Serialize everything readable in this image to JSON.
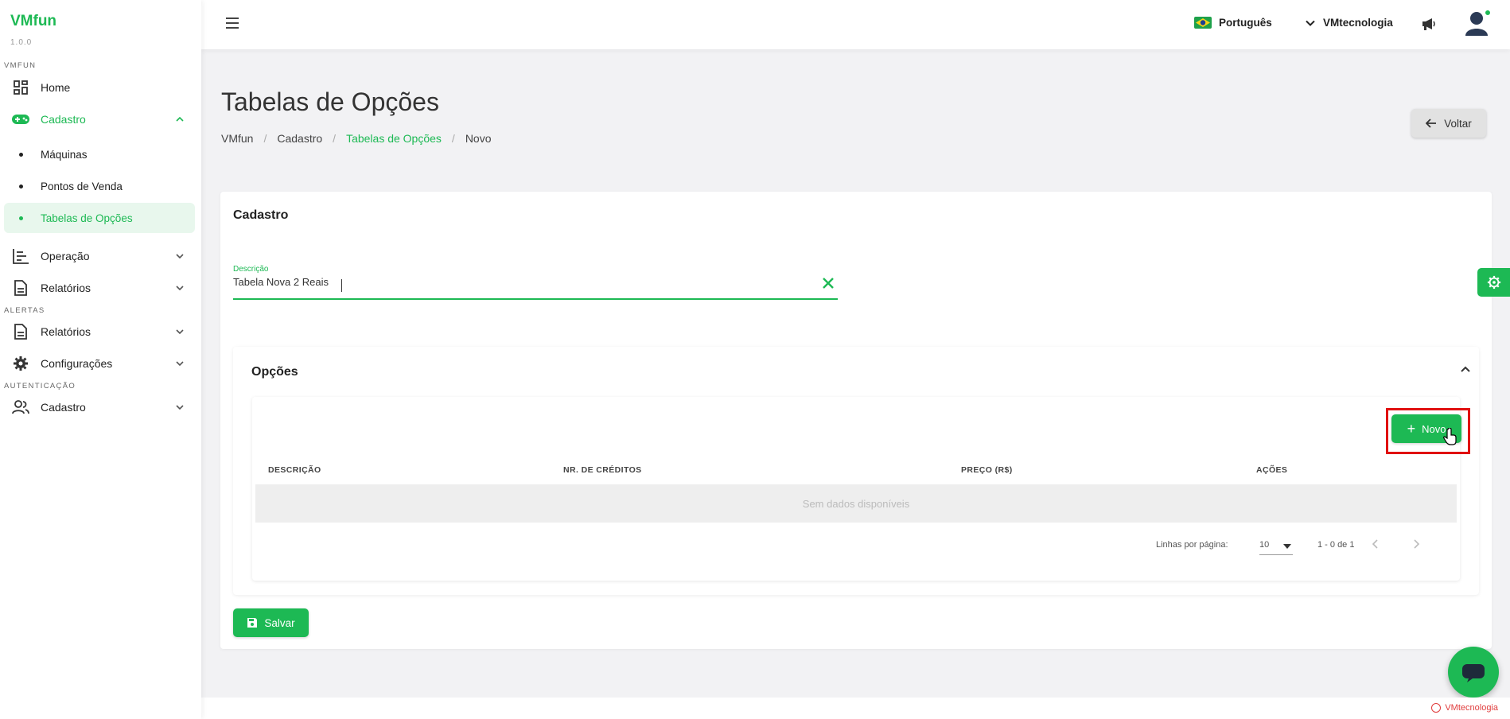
{
  "brand": {
    "name": "VMfun",
    "version": "1.0.0"
  },
  "sidebar": {
    "section_vmfun": "VMFUN",
    "section_alertas": "ALERTAS",
    "section_auth": "AUTENTICAÇÃO",
    "home": "Home",
    "cadastro": "Cadastro",
    "sub": [
      "Máquinas",
      "Pontos de Venda",
      "Tabelas de Opções"
    ],
    "operacao": "Operação",
    "relatorios": "Relatórios",
    "relatorios_alertas": "Relatórios",
    "configuracoes": "Configurações",
    "cadastro_auth": "Cadastro"
  },
  "topbar": {
    "language": "Português",
    "company": "VMtecnologia"
  },
  "page": {
    "title": "Tabelas de Opções",
    "breadcrumb": [
      "VMfun",
      "Cadastro",
      "Tabelas de Opções",
      "Novo"
    ],
    "back_label": "Voltar"
  },
  "form": {
    "title": "Cadastro",
    "descricao_label": "Descrição",
    "descricao_value": "Tabela Nova 2 Reais"
  },
  "options": {
    "title": "Opções",
    "new_label": "Novo",
    "columns": [
      "DESCRIÇÃO",
      "NR. DE CRÉDITOS",
      "PREÇO (R$)",
      "AÇÕES"
    ],
    "empty_text": "Sem dados disponíveis",
    "rows_per_page_label": "Linhas por página:",
    "rows_per_page": "10",
    "range": "1 - 0 de 1"
  },
  "save_label": "Salvar",
  "footer": {
    "powered": "VMtecnologia"
  },
  "colors": {
    "accent": "#1db954",
    "highlight": "#e01010"
  }
}
